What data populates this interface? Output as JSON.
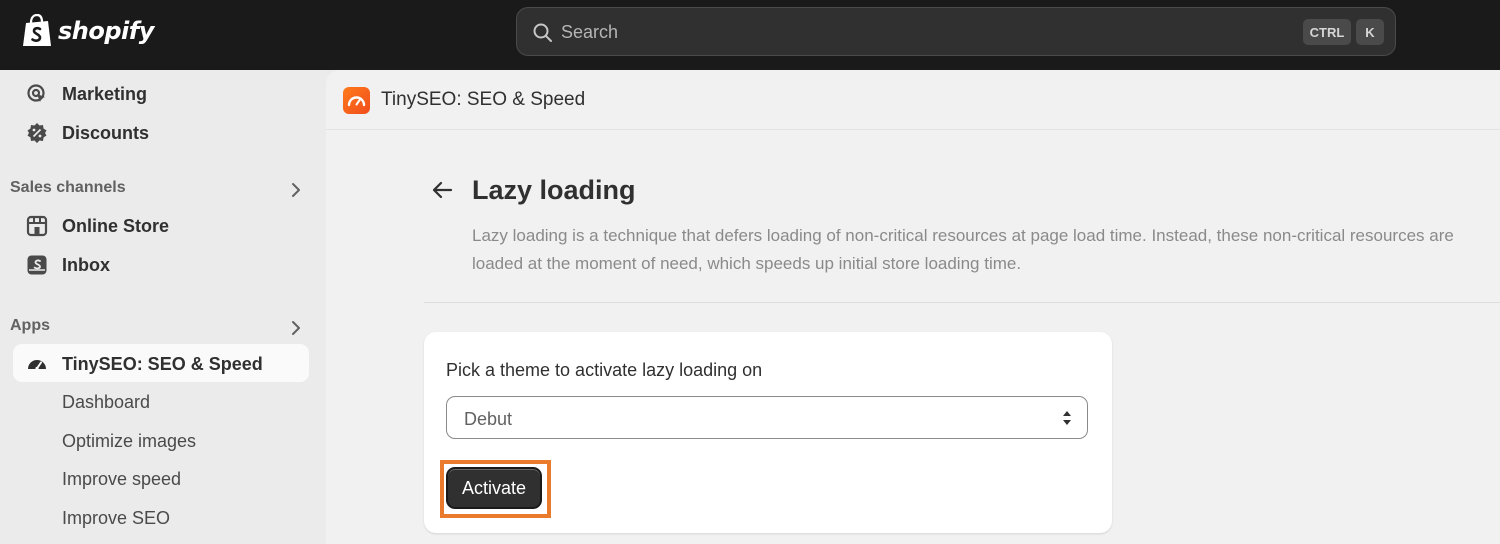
{
  "topbar": {
    "brand": "shopify",
    "search_placeholder": "Search",
    "shortcut_ctrl": "CTRL",
    "shortcut_k": "K"
  },
  "sidebar": {
    "items": [
      {
        "label": "Marketing",
        "icon": "target-icon"
      },
      {
        "label": "Discounts",
        "icon": "discount-icon"
      }
    ],
    "sales_channels": {
      "heading": "Sales channels",
      "items": [
        {
          "label": "Online Store",
          "icon": "store-icon"
        },
        {
          "label": "Inbox",
          "icon": "inbox-icon"
        }
      ]
    },
    "apps": {
      "heading": "Apps",
      "active_app": {
        "label": "TinySEO: SEO & Speed",
        "icon": "speedometer-icon"
      },
      "sub_items": [
        "Dashboard",
        "Optimize images",
        "Improve speed",
        "Improve SEO"
      ]
    }
  },
  "main": {
    "app_title": "TinySEO: SEO & Speed",
    "page_title": "Lazy loading",
    "description": "Lazy loading is a technique that defers loading of non-critical resources at page load time. Instead, these non-critical resources are loaded at the moment of need, which speeds up initial store loading time.",
    "card": {
      "label": "Pick a theme to activate lazy loading on",
      "select_value": "Debut",
      "button_label": "Activate"
    }
  },
  "colors": {
    "topbar": "#1a1a1a",
    "highlight": "#ea7b2c",
    "app_icon": "#f05a1c",
    "button": "#303030"
  }
}
